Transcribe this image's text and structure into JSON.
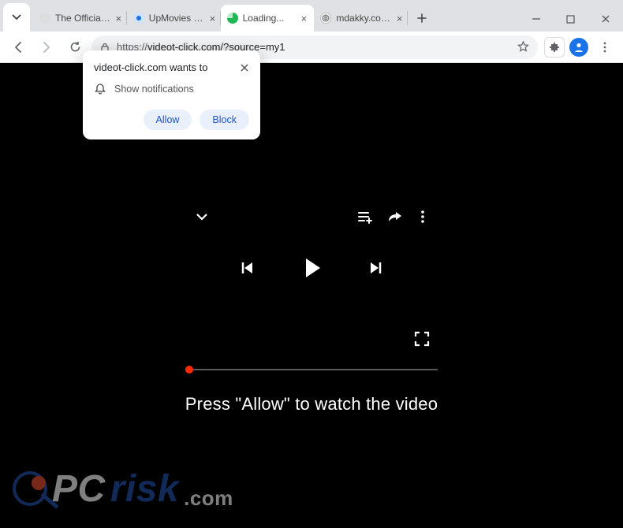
{
  "tabs": [
    {
      "title": "The Official Home of",
      "favicon_color": "#b0b0b0"
    },
    {
      "title": "UpMovies - Watch FR",
      "favicon_color": "#1a73e8"
    },
    {
      "title": "Loading...",
      "favicon_color": "#1db954",
      "active": true
    },
    {
      "title": "mdakky.com/phclcm",
      "favicon_color": "#888888"
    }
  ],
  "toolbar": {
    "url_scheme": "https://",
    "url_rest": "videot-click.com/?source=my1"
  },
  "notification": {
    "title": "videot-click.com wants to",
    "line": "Show notifications",
    "allow": "Allow",
    "block": "Block"
  },
  "page": {
    "prompt": "Press \"Allow\" to watch the video"
  },
  "watermark": {
    "pc": "PC",
    "risk": "risk",
    "com": ".com"
  }
}
